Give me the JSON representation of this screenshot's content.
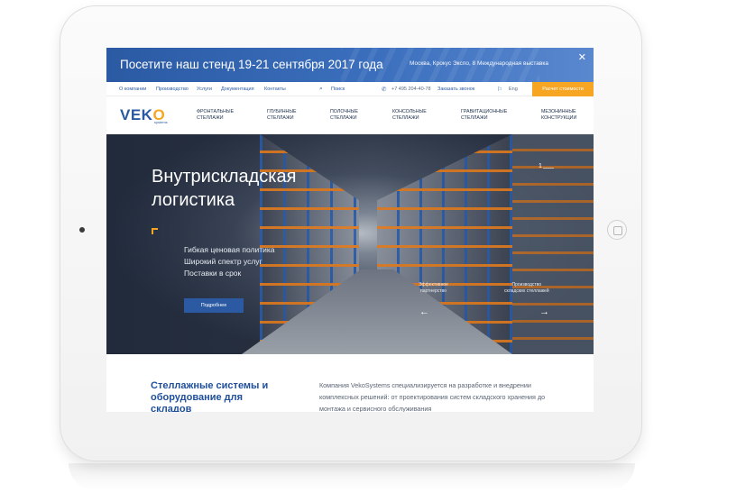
{
  "banner": {
    "title": "Посетите наш стенд 19-21 сентября 2017 года",
    "info": "Москва, Крокус Экспо, 8 Международная выставка",
    "close_icon": "close-icon"
  },
  "topbar": {
    "links": [
      "О компании",
      "Производство",
      "Услуги",
      "Документация",
      "Контакты"
    ],
    "search_label": "Поиск",
    "phone": "+7 495 204-40-78",
    "callback": "Заказать звонок",
    "lang": "Eng",
    "cta": "Расчет стоимости"
  },
  "logo": {
    "word": "VEK",
    "swoosh": "O",
    "sub": "systems"
  },
  "nav": [
    {
      "line1": "Фронтальные",
      "line2": "стеллажи"
    },
    {
      "line1": "Глубинные",
      "line2": "стеллажи"
    },
    {
      "line1": "Полочные",
      "line2": "стеллажи"
    },
    {
      "line1": "Консольные",
      "line2": "стеллажи"
    },
    {
      "line1": "Гравитационные",
      "line2": "стеллажи"
    },
    {
      "line1": "Мезонинные",
      "line2": "конструкции"
    }
  ],
  "hero": {
    "title": "Внутрискладская логистика",
    "points": [
      "Гибкая ценовая политика",
      "Широкий спектр услуг",
      "Поставки в срок"
    ],
    "button": "Подробнее",
    "slide_number": "1",
    "prev_label_1": "Эффективное",
    "prev_label_2": "партнерство",
    "next_label_1": "Производство",
    "next_label_2": "складских стеллажей",
    "prev_arrow": "←",
    "next_arrow": "→"
  },
  "content": {
    "title": "Стеллажные системы и оборудование для складов",
    "text": "Компания VekoSystems специализируется на разработке и внедрении комплексных решений: от проектирования систем складского хранения до монтажа и сервисного обслуживания"
  },
  "colors": {
    "brand_blue": "#2b5aa3",
    "accent_orange": "#f6a623"
  }
}
